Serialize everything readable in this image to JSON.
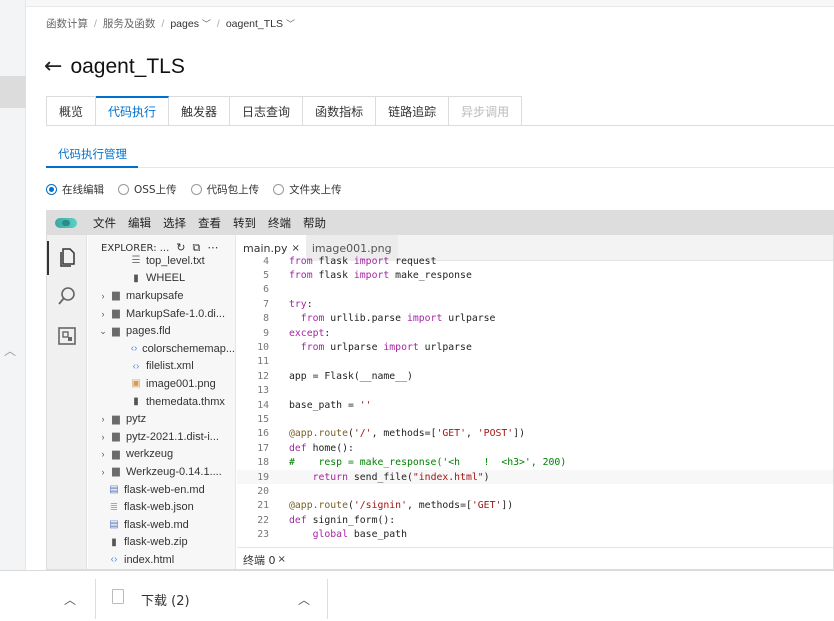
{
  "breadcrumb": {
    "items": [
      "函数计算",
      "服务及函数",
      "pages",
      "oagent_TLS"
    ],
    "separator": "/"
  },
  "page": {
    "title": "oagent_TLS"
  },
  "tabs": [
    {
      "label": "概览"
    },
    {
      "label": "代码执行"
    },
    {
      "label": "触发器"
    },
    {
      "label": "日志查询"
    },
    {
      "label": "函数指标"
    },
    {
      "label": "链路追踪"
    },
    {
      "label": "异步调用"
    }
  ],
  "active_tab": "代码执行",
  "subtab": {
    "label": "代码执行管理"
  },
  "upload_options": [
    "在线编辑",
    "OSS上传",
    "代码包上传",
    "文件夹上传"
  ],
  "selected_upload": "在线编辑",
  "ide": {
    "menu": [
      "文件",
      "编辑",
      "选择",
      "查看",
      "转到",
      "终端",
      "帮助"
    ],
    "explorer_title": "EXPLORER: ...",
    "tree": [
      {
        "label": "top_level.txt",
        "icon": "file-lines-icon",
        "indent": 2,
        "arrow": ""
      },
      {
        "label": "WHEEL",
        "icon": "file-icon",
        "indent": 2,
        "arrow": ""
      },
      {
        "label": "markupsafe",
        "icon": "folder-icon",
        "indent": 1,
        "arrow": "›"
      },
      {
        "label": "MarkupSafe-1.0.di...",
        "icon": "folder-icon",
        "indent": 1,
        "arrow": "›"
      },
      {
        "label": "pages.fld",
        "icon": "folder-icon",
        "indent": 1,
        "arrow": "⌄"
      },
      {
        "label": "colorschememap...",
        "icon": "code-icon",
        "indent": 2,
        "arrow": ""
      },
      {
        "label": "filelist.xml",
        "icon": "code-icon",
        "indent": 2,
        "arrow": ""
      },
      {
        "label": "image001.png",
        "icon": "image-icon",
        "indent": 2,
        "arrow": ""
      },
      {
        "label": "themedata.thmx",
        "icon": "file-icon",
        "indent": 2,
        "arrow": ""
      },
      {
        "label": "pytz",
        "icon": "folder-icon",
        "indent": 1,
        "arrow": "›"
      },
      {
        "label": "pytz-2021.1.dist-i...",
        "icon": "folder-icon",
        "indent": 1,
        "arrow": "›"
      },
      {
        "label": "werkzeug",
        "icon": "folder-icon",
        "indent": 1,
        "arrow": "›"
      },
      {
        "label": "Werkzeug-0.14.1....",
        "icon": "folder-icon",
        "indent": 1,
        "arrow": "›"
      },
      {
        "label": "flask-web-en.md",
        "icon": "markdown-icon",
        "indent": 0,
        "arrow": ""
      },
      {
        "label": "flask-web.json",
        "icon": "json-icon",
        "indent": 0,
        "arrow": ""
      },
      {
        "label": "flask-web.md",
        "icon": "markdown-icon",
        "indent": 0,
        "arrow": ""
      },
      {
        "label": "flask-web.zip",
        "icon": "file-icon",
        "indent": 0,
        "arrow": ""
      },
      {
        "label": "index.html",
        "icon": "code-icon",
        "indent": 0,
        "arrow": ""
      }
    ],
    "editor_tabs": [
      {
        "label": "main.py",
        "close": "×",
        "active": true
      },
      {
        "label": "image001.png",
        "close": "",
        "active": false
      }
    ],
    "code_lines": [
      {
        "n": "4",
        "t": "from flask import request"
      },
      {
        "n": "5",
        "t": "from flask import make_response"
      },
      {
        "n": "6",
        "t": ""
      },
      {
        "n": "7",
        "t": "try:"
      },
      {
        "n": "8",
        "t": "  from urllib.parse import urlparse"
      },
      {
        "n": "9",
        "t": "except:"
      },
      {
        "n": "10",
        "t": "  from urlparse import urlparse"
      },
      {
        "n": "11",
        "t": ""
      },
      {
        "n": "12",
        "t": "app = Flask(__name__)"
      },
      {
        "n": "13",
        "t": ""
      },
      {
        "n": "14",
        "t": "base_path = ''"
      },
      {
        "n": "15",
        "t": ""
      },
      {
        "n": "16",
        "t": "@app.route('/', methods=['GET', 'POST'])"
      },
      {
        "n": "17",
        "t": "def home():"
      },
      {
        "n": "18",
        "t": "#    resp = make_response('<h    !  <h3>', 200)"
      },
      {
        "n": "19",
        "t": "    return send_file(\"index.html\")"
      },
      {
        "n": "20",
        "t": ""
      },
      {
        "n": "21",
        "t": "@app.route('/signin', methods=['GET'])"
      },
      {
        "n": "22",
        "t": "def signin_form():"
      },
      {
        "n": "23",
        "t": "    global base_path"
      }
    ],
    "current_line": "19",
    "terminal_label": "终端 0",
    "terminal_close": "×"
  },
  "downloads": {
    "label": "下载 (2)"
  },
  "colors": {
    "accent": "#0070cc",
    "menubar": "#dddddd"
  }
}
